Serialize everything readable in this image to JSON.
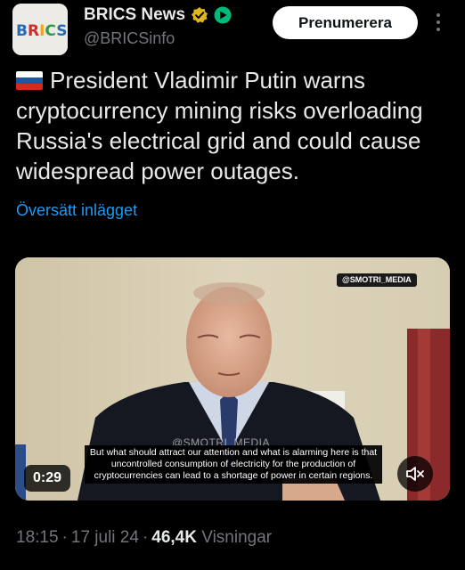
{
  "account": {
    "display_name": "BRICS News",
    "handle": "@BRICSinfo",
    "avatar_text": "BRICS",
    "verified_badge_color": "#e2b719",
    "affiliate_badge_color": "#00ba7c"
  },
  "actions": {
    "subscribe_label": "Prenumerera",
    "more_icon": "more-vertical-icon"
  },
  "tweet": {
    "flag": "russia-flag",
    "text": "President Vladimir Putin warns cryptocurrency mining risks overloading Russia's electrical grid and could cause widespread power outages.",
    "translate_label": "Översätt inlägget"
  },
  "video": {
    "watermark": "@SMOTRI_MEDIA",
    "faint_watermark": "@SMOTRI_MEDIA",
    "subtitle": "But what should attract our attention and what is alarming here is that uncontrolled consumption of electricity for the production of cryptocurrencies can lead to a shortage of power in certain regions.",
    "duration": "0:29",
    "mute_icon": "speaker-muted-icon"
  },
  "meta": {
    "time": "18:15",
    "date": "17 juli 24",
    "separator": "·",
    "views_count": "46,4K",
    "views_label": "Visningar"
  },
  "colors": {
    "background": "#000000",
    "text": "#e7e9ea",
    "secondary": "#71767b",
    "link": "#1d9bf0"
  }
}
